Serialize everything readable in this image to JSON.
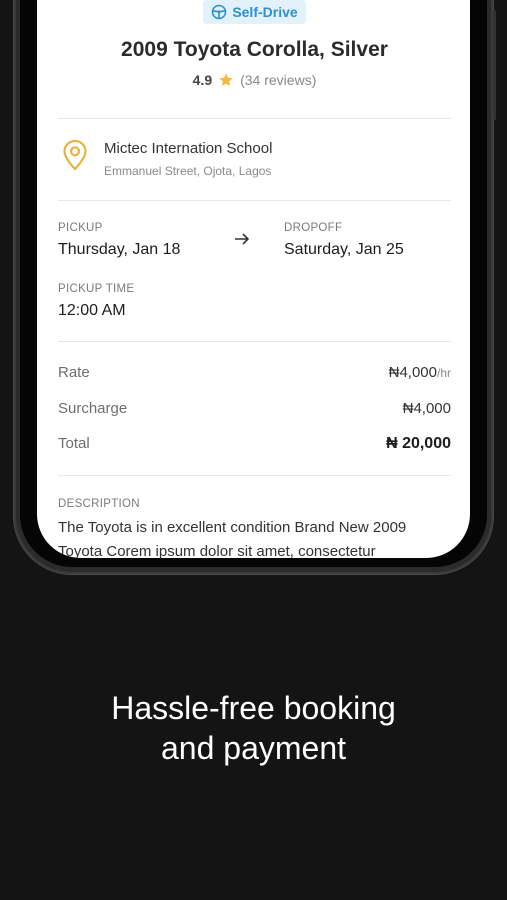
{
  "listing": {
    "badge": "Self-Drive",
    "title": "2009 Toyota Corolla, Silver",
    "rating": "4.9",
    "reviews": "(34 reviews)"
  },
  "location": {
    "name": "Mictec Internation School",
    "address": "Emmanuel Street, Ojota, Lagos"
  },
  "schedule": {
    "pickup_label": "PICKUP",
    "pickup_date": "Thursday, Jan 18",
    "dropoff_label": "DROPOFF",
    "dropoff_date": "Saturday, Jan 25",
    "pickup_time_label": "PICKUP TIME",
    "pickup_time": "12:00 AM"
  },
  "pricing": {
    "rate_label": "Rate",
    "rate_value": "₦4,000",
    "rate_unit": "/hr",
    "surcharge_label": "Surcharge",
    "surcharge_value": "₦4,000",
    "total_label": "Total",
    "total_value": "₦ 20,000"
  },
  "description": {
    "label": "DESCRIPTION",
    "text": "The Toyota is in excellent condition Brand New 2009 Toyota Corem ipsum dolor sit amet, consectetur"
  },
  "tagline": {
    "line1": "Hassle-free booking",
    "line2": "and payment"
  },
  "colors": {
    "accent_blue": "#2d8fce",
    "badge_bg": "#e3f1fb",
    "star": "#f5b93b",
    "pin": "#e8b23c",
    "background": "#141414"
  }
}
